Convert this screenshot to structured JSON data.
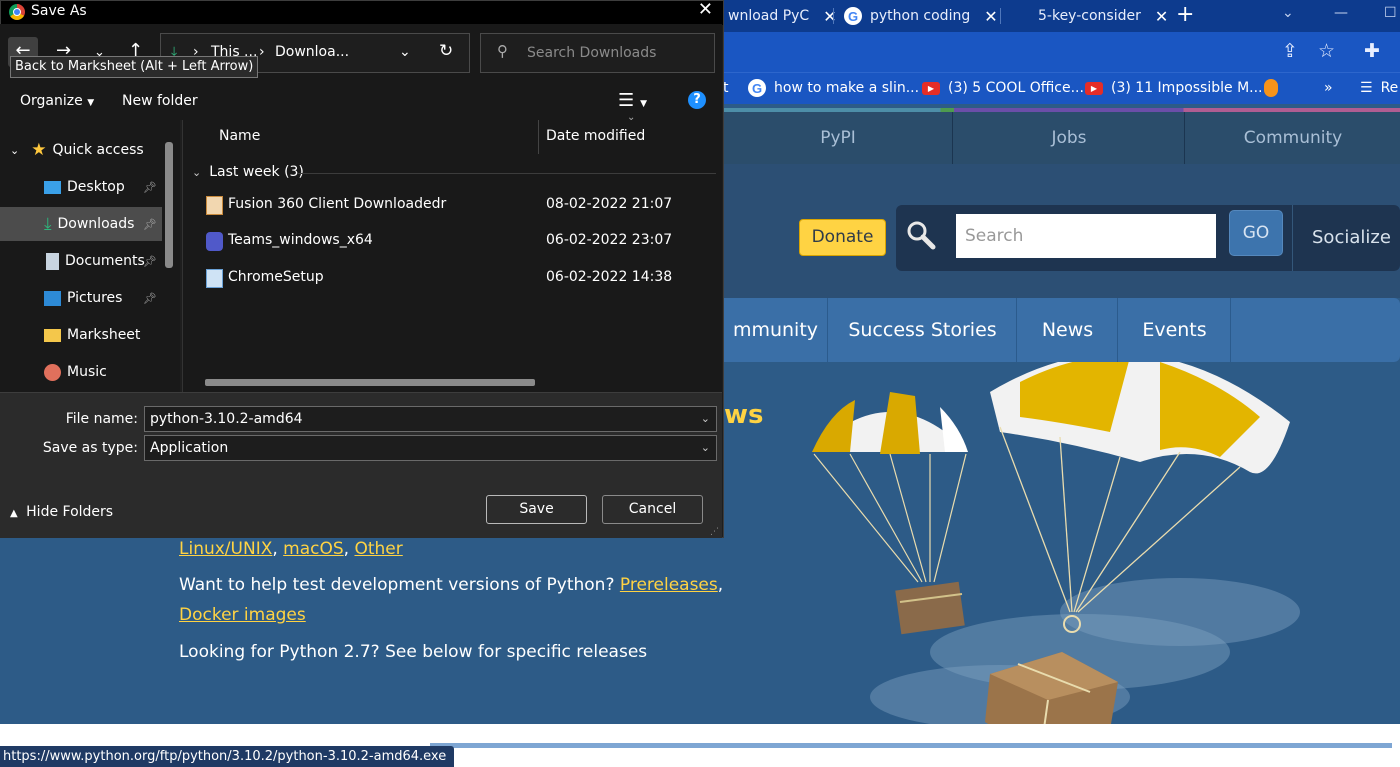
{
  "browser": {
    "tabs": [
      {
        "label": "wnload PyC",
        "icon": "python-icon"
      },
      {
        "label": "python coding",
        "icon": "google-icon"
      },
      {
        "label": "5-key-consider",
        "icon": ""
      }
    ],
    "bookmarks": [
      {
        "label": "how to make a slin...",
        "icon": "google-icon"
      },
      {
        "label": "(3) 5 COOL Office...",
        "icon": "youtube-icon"
      },
      {
        "label": "(3) 11 Impossible M...",
        "icon": "youtube-icon"
      }
    ],
    "bookmarks_more": "»",
    "reading_list": "Re",
    "status_url": "https://www.python.org/ftp/python/3.10.2/python-3.10.2-amd64.exe"
  },
  "python_site": {
    "topnav": [
      "PyPI",
      "Jobs",
      "Community"
    ],
    "donate": "Donate",
    "search_placeholder": "Search",
    "go": "GO",
    "socialize": "Socialize",
    "mainnav": [
      "mmunity",
      "Success Stories",
      "News",
      "Events"
    ],
    "hero_title_fragment": "ws",
    "os_links": [
      "Linux/UNIX",
      "macOS",
      "Other"
    ],
    "prerelease_text": "Want to help test development versions of Python?",
    "prerelease_link": "Prereleases",
    "docker_link": "Docker images",
    "py27_text": "Looking for Python 2.7? See below for specific releases"
  },
  "dialog": {
    "title": "Save As",
    "tooltip": "Back to Marksheet (Alt + Left Arrow)",
    "address": [
      "This ...",
      "Downloa..."
    ],
    "search_placeholder": "Search Downloads",
    "organize": "Organize",
    "new_folder": "New folder",
    "nav": [
      {
        "label": "Quick access",
        "icon": "star-icon",
        "pinned": false,
        "selected": false
      },
      {
        "label": "Desktop",
        "icon": "desktop-icon",
        "pinned": true,
        "selected": false
      },
      {
        "label": "Downloads",
        "icon": "download-icon",
        "pinned": true,
        "selected": true
      },
      {
        "label": "Documents",
        "icon": "documents-icon",
        "pinned": true,
        "selected": false
      },
      {
        "label": "Pictures",
        "icon": "pictures-icon",
        "pinned": true,
        "selected": false
      },
      {
        "label": "Marksheet",
        "icon": "folder-icon",
        "pinned": false,
        "selected": false
      },
      {
        "label": "Music",
        "icon": "music-icon",
        "pinned": false,
        "selected": false
      }
    ],
    "columns": {
      "name": "Name",
      "date": "Date modified"
    },
    "group": "Last week (3)",
    "files": [
      {
        "name": "Fusion 360 Client Downloadedr",
        "date": "08-02-2022 21:07",
        "icon": "installer-icon"
      },
      {
        "name": "Teams_windows_x64",
        "date": "06-02-2022 23:07",
        "icon": "teams-icon"
      },
      {
        "name": "ChromeSetup",
        "date": "06-02-2022 14:38",
        "icon": "setup-icon"
      }
    ],
    "file_name_label": "File name:",
    "file_name_value": "python-3.10.2-amd64",
    "save_type_label": "Save as type:",
    "save_type_value": "Application",
    "hide_folders": "Hide Folders",
    "save": "Save",
    "cancel": "Cancel"
  }
}
